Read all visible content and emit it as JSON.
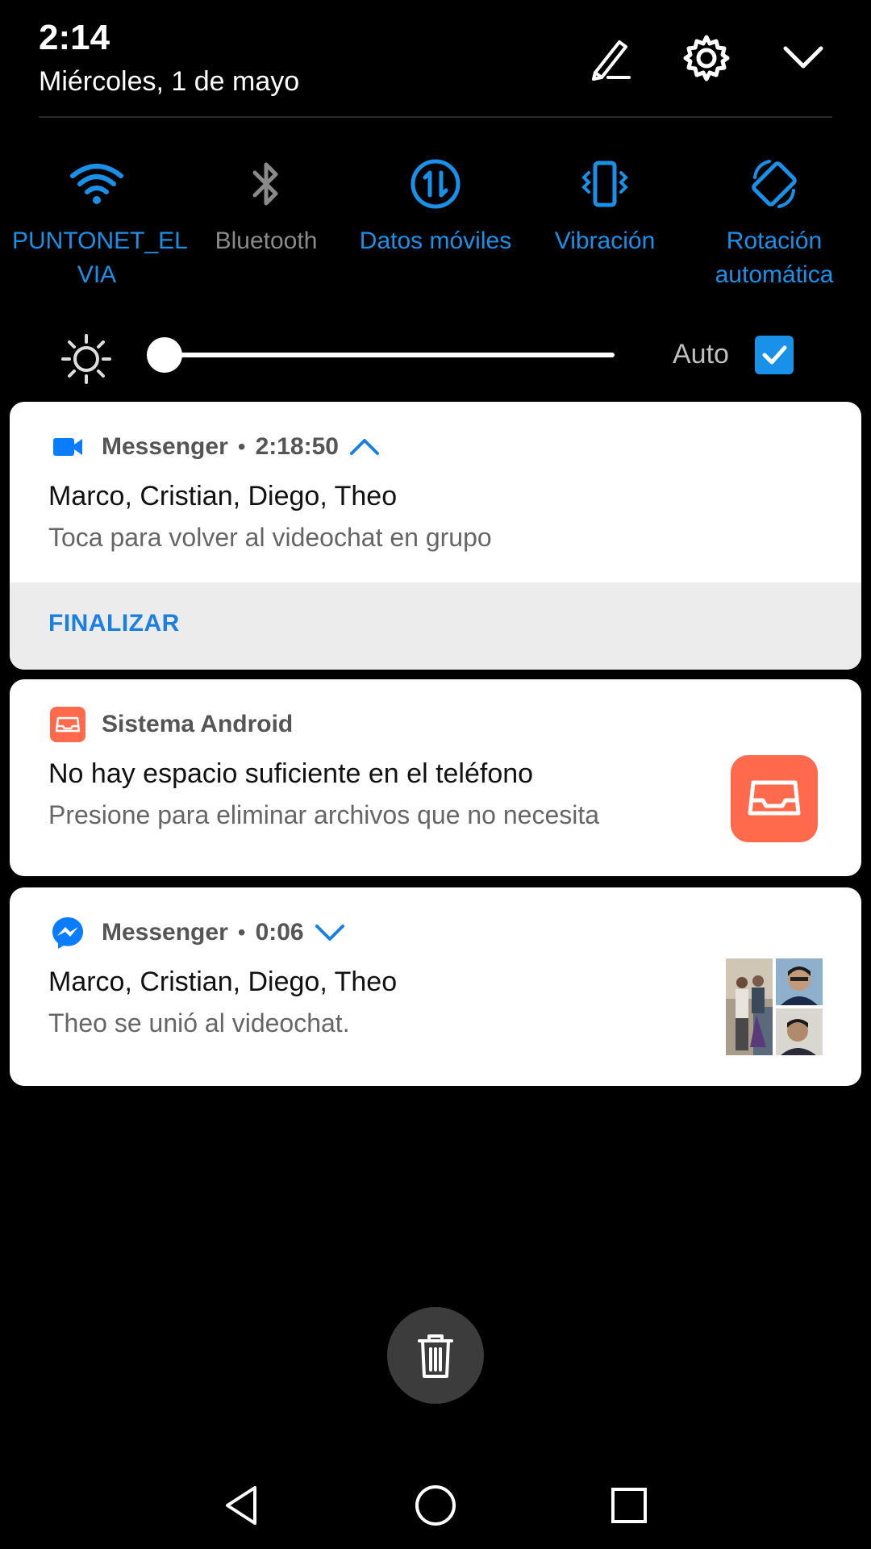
{
  "header": {
    "time": "2:14",
    "date": "Miércoles, 1 de mayo",
    "icons": [
      "edit-icon",
      "gear-icon",
      "chevron-down-icon"
    ]
  },
  "quick_settings": {
    "tiles": [
      {
        "label": "PUNTONET_EL VIA",
        "icon": "wifi-icon",
        "active": true
      },
      {
        "label": "Bluetooth",
        "icon": "bluetooth-icon",
        "active": false
      },
      {
        "label": "Datos móviles",
        "icon": "mobile-data-icon",
        "active": true
      },
      {
        "label": "Vibración",
        "icon": "vibrate-icon",
        "active": true
      },
      {
        "label": "Rotación automática",
        "icon": "auto-rotate-icon",
        "active": true
      }
    ],
    "brightness": {
      "level": 0,
      "auto_label": "Auto",
      "auto_checked": true
    }
  },
  "notifications": [
    {
      "app": "Messenger",
      "time": "2:18:50",
      "icon": "video-camera-icon",
      "title": "Marco, Cristian, Diego, Theo",
      "body": "Toca para volver al videochat en grupo",
      "action": "FINALIZAR",
      "expanded": true
    },
    {
      "app": "Sistema Android",
      "icon": "storage-tray-icon",
      "title": "No hay espacio suficiente en el teléfono",
      "body": "Presione para eliminar archivos que no necesita"
    },
    {
      "app": "Messenger",
      "time": "0:06",
      "icon": "messenger-icon",
      "title": "Marco, Cristian, Diego, Theo",
      "body": "Theo se unió al videochat.",
      "expanded": false
    }
  ],
  "colors": {
    "accent": "#1a91e8",
    "inactive": "#8a8a8a",
    "storage_orange": "#ff6a4d",
    "messenger_blue": "#0a7cff"
  }
}
